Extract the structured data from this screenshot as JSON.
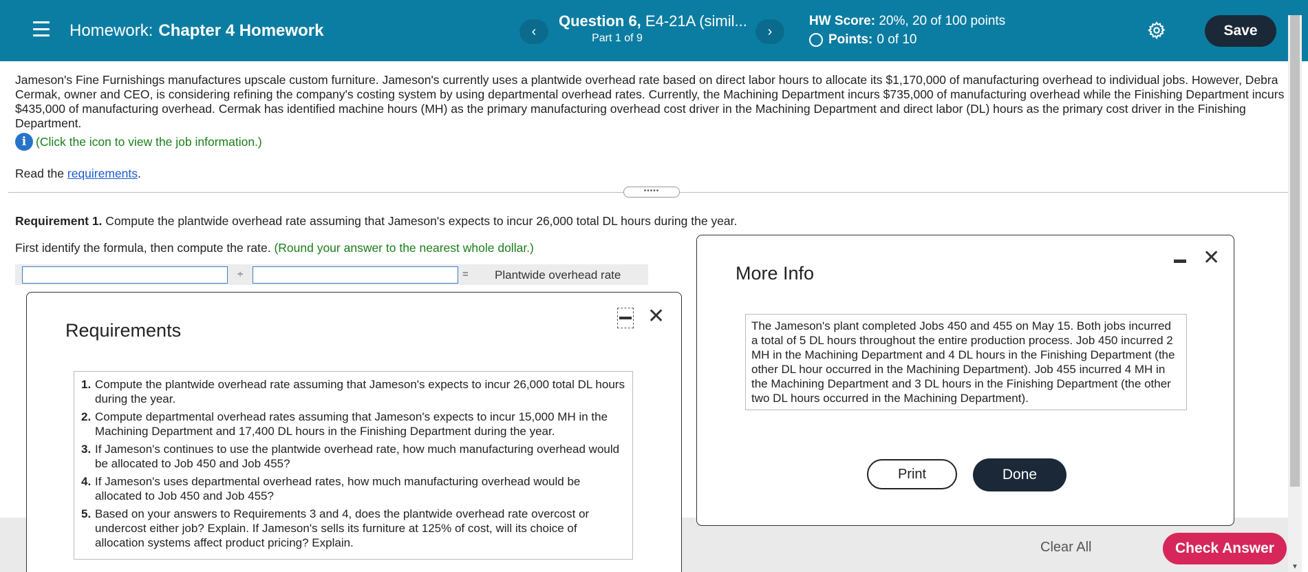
{
  "header": {
    "hw_label": "Homework:",
    "hw_name": "Chapter 4 Homework",
    "question_bold": "Question 6,",
    "question_rest": " E4-21A (simil...",
    "part": "Part 1 of 9",
    "score_label": "HW Score:",
    "score_value": " 20%, 20 of 100 points",
    "points_label": "Points:",
    "points_value": "0 of 10",
    "save_label": "Save",
    "prev_label": "‹",
    "next_label": "›"
  },
  "problem": {
    "text": "Jameson's Fine Furnishings manufactures upscale custom furniture. Jameson's currently uses a plantwide overhead rate based on direct labor hours to allocate its $1,170,000 of manufacturing overhead to individual jobs. However, Debra Cermak, owner and CEO, is considering refining the company's costing system by using departmental overhead rates. Currently, the Machining Department incurs $735,000 of manufacturing overhead while the Finishing Department incurs $435,000 of manufacturing overhead. Cermak has identified machine hours (MH) as the primary manufacturing overhead cost driver in the Machining Department and direct labor (DL) hours as the primary cost driver in the Finishing Department.",
    "info_link": "(Click the icon to view the job information.)",
    "read_prefix": "Read the ",
    "read_link": "requirements",
    "read_suffix": ".",
    "divider_handle": "•••••"
  },
  "requirement1": {
    "label": "Requirement 1.",
    "text": " Compute the plantwide overhead rate assuming that Jameson's expects to incur 26,000 total DL hours during the year.",
    "hint": "First identify the formula, then compute the rate. ",
    "hint_green": "(Round your answer to the nearest whole dollar.)",
    "input_a": "",
    "input_b": "",
    "op_div": "÷",
    "op_eq": "=",
    "result_label": "Plantwide overhead rate"
  },
  "requirements_popup": {
    "title": "Requirements",
    "items": [
      {
        "num": "1.",
        "text": "Compute the plantwide overhead rate assuming that Jameson's expects to incur 26,000 total DL hours during the year."
      },
      {
        "num": "2.",
        "text": "Compute departmental overhead rates assuming that Jameson's expects to incur 15,000 MH in the Machining Department and 17,400 DL hours in the Finishing Department during the year."
      },
      {
        "num": "3.",
        "text": "If Jameson's continues to use the plantwide overhead rate, how much manufacturing overhead would be allocated to Job 450 and Job 455?"
      },
      {
        "num": "4.",
        "text": "If Jameson's uses departmental overhead rates, how much manufacturing overhead would be allocated to Job 450 and Job 455?"
      },
      {
        "num": "5.",
        "text": "Based on your answers to Requirements 3 and 4, does the plantwide overhead rate overcost or undercost either job? Explain. If Jameson's sells its furniture at 125% of cost, will its choice of allocation systems affect product pricing? Explain."
      }
    ]
  },
  "info_popup": {
    "title": "More Info",
    "text": "The Jameson's plant completed Jobs 450 and 455 on May 15. Both jobs incurred a total of 5 DL hours throughout the entire production process. Job 450 incurred 2 MH in the Machining Department and 4 DL hours in the Finishing Department (the other DL hour occurred in the Machining Department). Job 455 incurred 4 MH in the Machining Department and 3 DL hours in the Finishing Department (the other two DL hours occurred in the Machining Department).",
    "print_label": "Print",
    "done_label": "Done"
  },
  "footer": {
    "clear_label": "Clear All",
    "check_label": "Check Answer"
  },
  "colors": {
    "header_bg": "#0c7da2",
    "save_bg": "#1b2837",
    "check_bg": "#d6265a",
    "hint_green": "#1a7f1a",
    "link_blue": "#1d5bd0"
  },
  "icons": [
    "menu-icon",
    "chevron-left-icon",
    "chevron-right-icon",
    "gear-icon",
    "info-icon",
    "minimize-icon",
    "close-icon"
  ]
}
